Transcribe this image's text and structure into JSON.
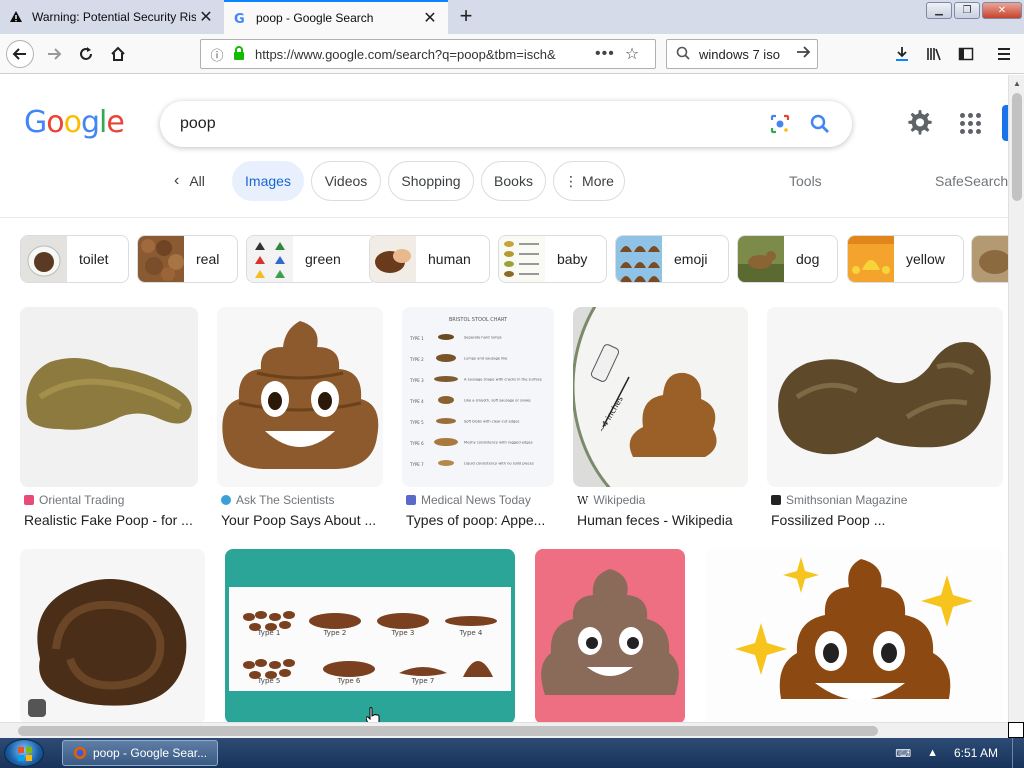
{
  "browser": {
    "tabs": [
      {
        "title": "Warning: Potential Security Risk",
        "icon": "warning-icon",
        "active": false
      },
      {
        "title": "poop - Google Search",
        "icon": "google-favicon",
        "active": true
      }
    ],
    "url": "https://www.google.com/search?q=poop&tbm=isch&",
    "search_box_value": "windows 7 iso"
  },
  "google": {
    "logo_letters": [
      "G",
      "o",
      "o",
      "g",
      "l",
      "e"
    ],
    "logo_colors": [
      "#4285F4",
      "#EA4335",
      "#FBBC05",
      "#4285F4",
      "#34A853",
      "#EA4335"
    ],
    "query": "poop",
    "filter_tabs": [
      {
        "label": "All",
        "icon": "chevron-left-icon"
      },
      {
        "label": "Images",
        "active": true
      },
      {
        "label": "Videos"
      },
      {
        "label": "Shopping"
      },
      {
        "label": "Books"
      },
      {
        "label": "More",
        "icon": "vertical-dots-icon"
      }
    ],
    "tools_label": "Tools",
    "safesearch_label": "SafeSearch",
    "refinements": [
      {
        "label": "toilet"
      },
      {
        "label": "real"
      },
      {
        "label": "green"
      },
      {
        "label": "human"
      },
      {
        "label": "baby"
      },
      {
        "label": "emoji"
      },
      {
        "label": "dog"
      },
      {
        "label": "yellow"
      }
    ],
    "results_row1": [
      {
        "source": "Oriental Trading",
        "title": "Realistic Fake Poop - for ..."
      },
      {
        "source": "Ask The Scientists",
        "title": "Your Poop Says About ..."
      },
      {
        "source": "Medical News Today",
        "title": "Types of poop: Appe..."
      },
      {
        "source": "Wikipedia",
        "title": "Human feces - Wikipedia"
      },
      {
        "source": "Smithsonian Magazine",
        "title": "Fossilized Poop ..."
      }
    ],
    "stool_chart": {
      "title": "BRISTOL STOOL CHART",
      "types": [
        "TYPE 1",
        "TYPE 2",
        "TYPE 3",
        "TYPE 4",
        "TYPE 5",
        "TYPE 6",
        "TYPE 7"
      ],
      "descriptions": [
        "Separate hard lumps",
        "Lumpy and sausage like",
        "A sausage shape with cracks in the surface",
        "Like a smooth, soft sausage or snake",
        "Soft blobs with clear-cut edges",
        "Mushy consistency with ragged edges",
        "Liquid consistency with no solid pieces"
      ]
    },
    "types_figure": {
      "labels": [
        "Type 1",
        "Type 2",
        "Type 3",
        "Type 4",
        "Type 5",
        "Type 6",
        "Type 7"
      ]
    },
    "feces_image_label": "~4 inches"
  },
  "taskbar": {
    "task_label": "poop - Google Sear...",
    "clock": "6:51 AM"
  }
}
